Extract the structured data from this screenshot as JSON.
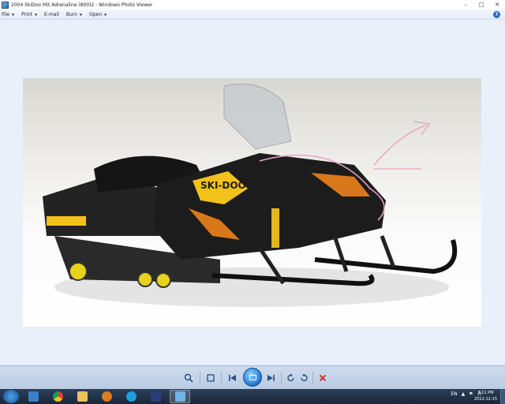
{
  "window": {
    "title": "2004 SkiDoo MX Adrenaline (800)2 - Windows Photo Viewer",
    "controls": [
      "minimize",
      "maximize",
      "close"
    ]
  },
  "menu": {
    "items": [
      {
        "label": "File",
        "has_dropdown": true
      },
      {
        "label": "Print",
        "has_dropdown": true
      },
      {
        "label": "E-mail",
        "has_dropdown": false
      },
      {
        "label": "Burn",
        "has_dropdown": true
      },
      {
        "label": "Open",
        "has_dropdown": true
      }
    ],
    "help_icon": "help-icon"
  },
  "photo": {
    "subject": "snowmobile",
    "brand_label": "SKI-DOO",
    "colors": {
      "body": "#1c1c1c",
      "decal_yellow": "#f2c21a",
      "decal_orange": "#d9781a",
      "annotation": "#e8a6c8"
    }
  },
  "toolbar": {
    "buttons": [
      "zoom-icon",
      "actual-size-icon",
      "previous-icon",
      "slideshow-icon",
      "next-icon",
      "rotate-counterclockwise-icon",
      "rotate-clockwise-icon",
      "delete-icon"
    ]
  },
  "taskbar": {
    "apps": [
      "explorer-icon",
      "chrome-icon",
      "folder-icon",
      "media-player-icon",
      "skype-icon",
      "photo-app-icon",
      "photo-viewer-icon"
    ],
    "language": "EN",
    "clock_time": "3:11 PM",
    "clock_date": "2012-12-15"
  }
}
